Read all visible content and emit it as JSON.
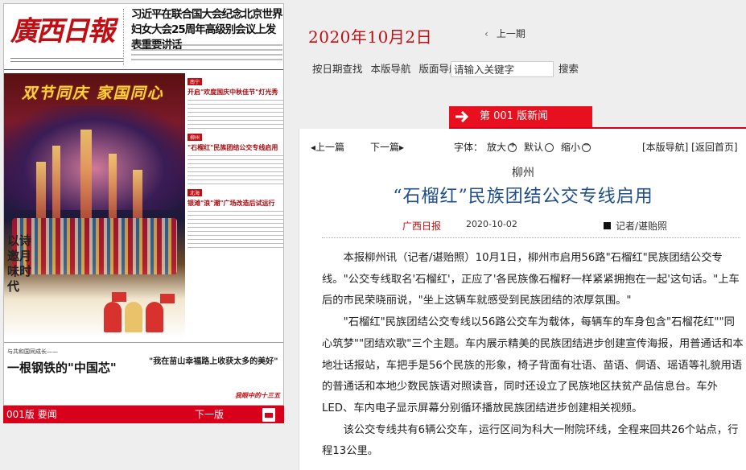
{
  "paper": {
    "masthead_logo": "廣西日報",
    "masthead_headline": "习近平在联合国大会纪念北京世界妇女大会25周年高级别会议上发表重要讲话",
    "photo_title": "双节同庆 家国同心",
    "vertical_text": "以诗邀月味时代",
    "right_col": [
      {
        "tag": "南宁",
        "head": "开启\"欢度国庆中秋佳节\"灯光秀"
      },
      {
        "tag": "柳州",
        "head": "\"石榴红\"民族团结公交专线启用"
      },
      {
        "tag": "北海",
        "head": "银滩\"浪\"潮\"广场改造后试运行"
      }
    ],
    "bottom_a_small": "与共和国同成长——",
    "bottom_a_big": "一根钢铁的\"中国芯\"",
    "bottom_b": "\"我在苗山幸福路上收获太多的美好\"",
    "bottom_c": "我眼中的十三五"
  },
  "page_bar": {
    "label": "001版 要闻",
    "next": "下一版"
  },
  "header": {
    "date": "2020年10月2日",
    "prev_issue": "上一期",
    "nav": [
      "按日期查找",
      "本版导航",
      "版面导航"
    ],
    "search_placeholder": "请输入关键字",
    "search_button": "搜索"
  },
  "edition": {
    "label": "第 001 版新闻"
  },
  "tools": {
    "prev": "上一篇",
    "next": "下一篇",
    "font_label": "字体：",
    "bigger": "放大",
    "default": "默认",
    "smaller": "缩小",
    "links": "[本版导航] [返回首页]"
  },
  "article": {
    "kicker": "柳州",
    "title": "“石榴红”民族团结公交专线启用",
    "source": "广西日报",
    "date": "2020-10-02",
    "author": "记者/谌贻照",
    "paragraphs": [
      "本报柳州讯（记者/谌贻照）10月1日，柳州市启用56路\"石榴红\"民族团结公交专线。\"公交专线取名'石榴红'，正应了'各民族像石榴籽一样紧紧拥抱在一起'这句话。\"上车后的市民荣晓丽说，\"坐上这辆车就感受到民族团结的浓厚氛围。\"",
      "\"石榴红\"民族团结公交专线以56路公交车为载体，每辆车的车身包含\"石榴花红\"\"同心筑梦\"\"团结欢歌\"三个主题。车内展示精美的民族团结进步创建宣传海报，用普通话和本地壮话报站，车把手是56个民族的形象，椅子背面有壮语、苗语、侗语、瑶语等礼貌用语的普通话和本地少数民族语对照读音，同时还设立了民族地区扶贫产品信息台。车外LED、车内电子显示屏幕分别循环播放民族团结进步创建相关视频。",
      "该公交专线共有6辆公交车，运行区间为科大一附院环线，全程来回共26个站点，行程13公里。"
    ]
  },
  "colors": {
    "accent_red": "#d9001b",
    "date_red": "#c40d12",
    "title_blue": "#1f4e8c"
  }
}
